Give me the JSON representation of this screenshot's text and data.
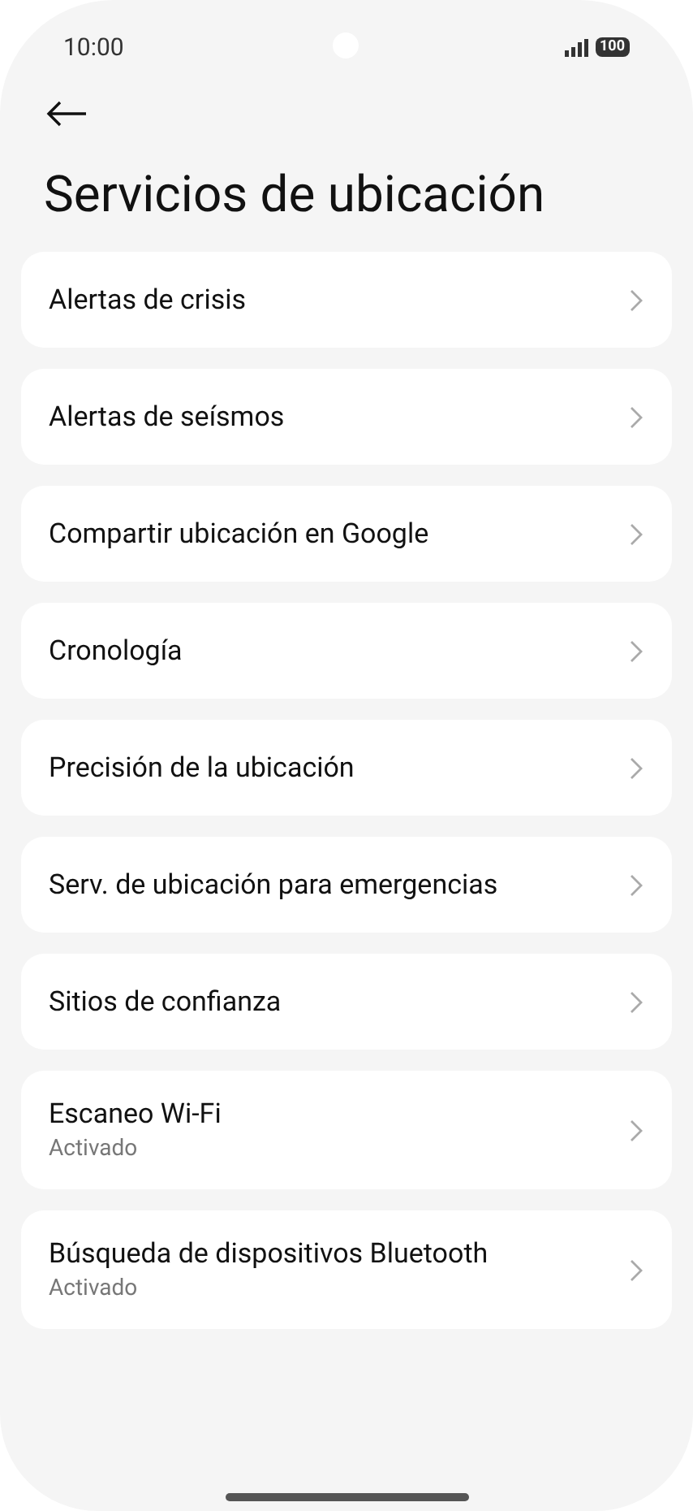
{
  "status_bar": {
    "time": "10:00",
    "battery": "100"
  },
  "title": "Servicios de ubicación",
  "items": [
    {
      "label": "Alertas de crisis"
    },
    {
      "label": "Alertas de seísmos"
    },
    {
      "label": "Compartir ubicación en Google"
    },
    {
      "label": "Cronología"
    },
    {
      "label": "Precisión de la ubicación"
    },
    {
      "label": "Serv. de ubicación para emergencias"
    },
    {
      "label": "Sitios de confianza"
    },
    {
      "label": "Escaneo Wi-Fi",
      "summary": "Activado"
    },
    {
      "label": "Búsqueda de dispositivos Bluetooth",
      "summary": "Activado"
    }
  ]
}
